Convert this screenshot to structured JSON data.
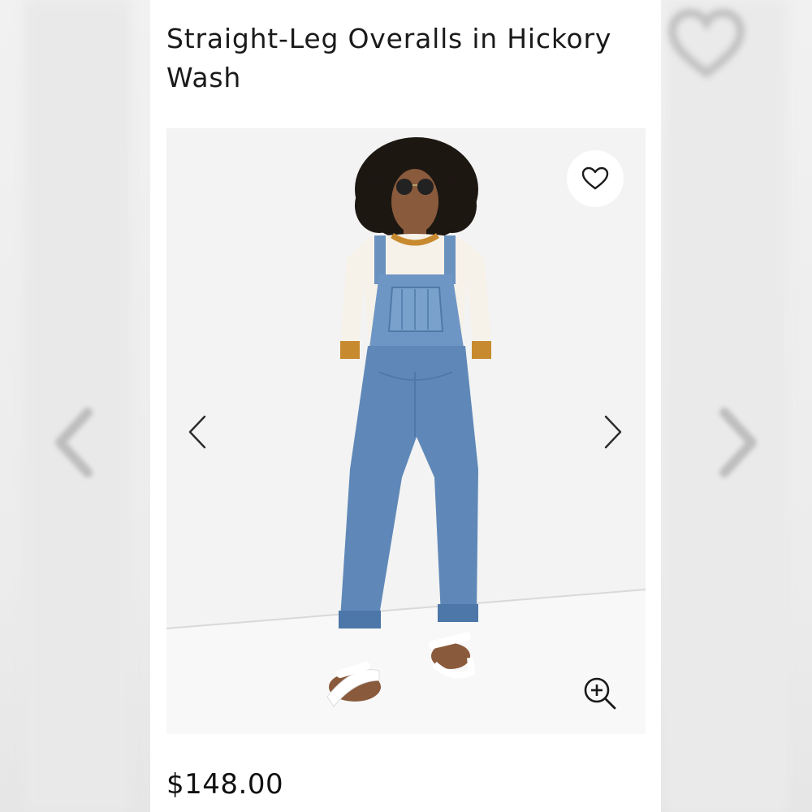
{
  "product": {
    "title": "Straight-Leg Overalls in Hickory Wash",
    "price": "$148.00"
  },
  "icons": {
    "favorite": "heart-outline-icon",
    "previous": "chevron-left-icon",
    "next": "chevron-right-icon",
    "zoom": "zoom-in-icon"
  },
  "colors": {
    "text": "#1a1a1a",
    "background": "#ececec",
    "card": "#ffffff",
    "denim": "#5f88b8"
  }
}
